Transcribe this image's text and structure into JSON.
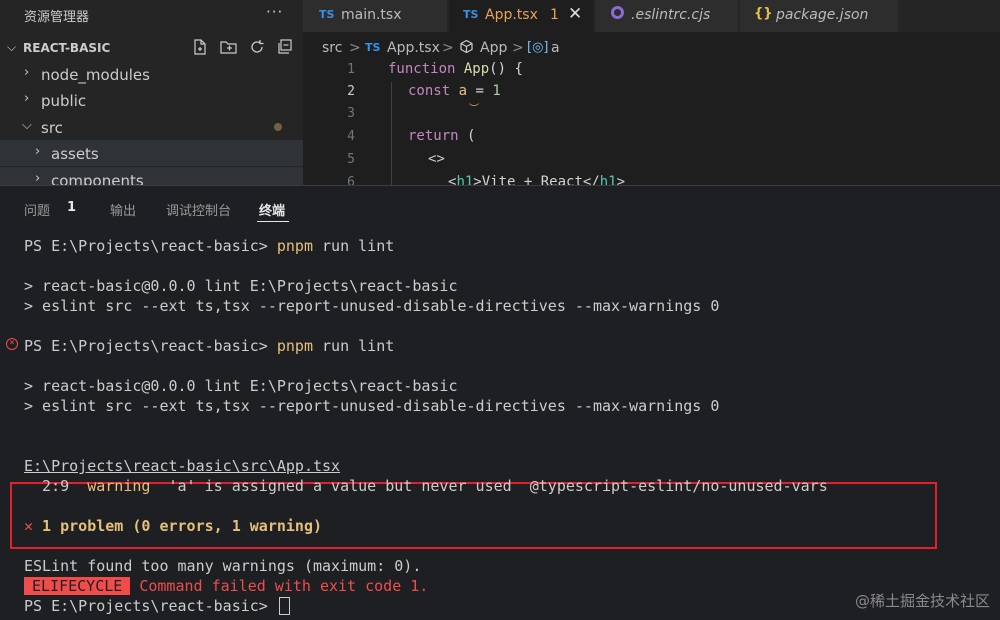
{
  "explorer": {
    "title": "资源管理器",
    "more": "···",
    "root": "REACT-BASIC",
    "items": [
      {
        "label": "node_modules"
      },
      {
        "label": "public"
      },
      {
        "label": "src"
      },
      {
        "label": "assets"
      },
      {
        "label": "components"
      }
    ]
  },
  "tabs": [
    {
      "prefix": "TS",
      "label": "main.tsx"
    },
    {
      "prefix": "TS",
      "label": "App.tsx",
      "count": "1",
      "close": "✕"
    },
    {
      "label": ".eslintrc.cjs"
    },
    {
      "prefix": "{}",
      "label": "package.json"
    }
  ],
  "breadcrumb": {
    "folder": "src",
    "sep": ">",
    "file_prefix": "TS",
    "file": "App.tsx",
    "symbol": "App",
    "variable": "a"
  },
  "code": {
    "line_numbers": [
      "1",
      "2",
      "3",
      "4",
      "5",
      "6"
    ],
    "l1_kw": "function",
    "l1_fn": "App",
    "l1_rest": "() {",
    "l2_kw": "const",
    "l2_var": "a",
    "l2_eq": " = ",
    "l2_num": "1",
    "l4_kw": "return",
    "l4_rest": " (",
    "l5": "<>",
    "l6_a": "<",
    "l6_tag": "h1",
    "l6_b": ">Vite + React</",
    "l6_tag2": "h1",
    "l6_c": ">"
  },
  "panel": {
    "tabs": [
      "问题",
      "输出",
      "调试控制台",
      "终端"
    ],
    "problems_count": "1"
  },
  "terminal": {
    "prompt": "PS E:\\Projects\\react-basic> ",
    "cmd_pnpm": "pnpm",
    "cmd_rest": " run lint",
    "out1": "> react-basic@0.0.0 lint E:\\Projects\\react-basic",
    "out2": "> eslint src --ext ts,tsx --report-unused-disable-directives --max-warnings 0",
    "error_mark": "×",
    "file": "E:\\Projects\\react-basic\\src\\App.tsx",
    "warn_pos": "  2:9  ",
    "warn_level": "warning",
    "warn_msg": "  'a' is assigned a value but never used  @typescript-eslint/no-unused-vars",
    "problem_x": "✕",
    "problem_text": " 1 problem (0 errors, 1 warning)",
    "found": "ESLint found too many warnings (maximum: 0).",
    "elifecycle": "ELIFECYCLE",
    "failed": " Command failed with exit code 1.",
    "last_prompt": "PS E:\\Projects\\react-basic> "
  },
  "watermark": "@稀土掘金技术社区"
}
